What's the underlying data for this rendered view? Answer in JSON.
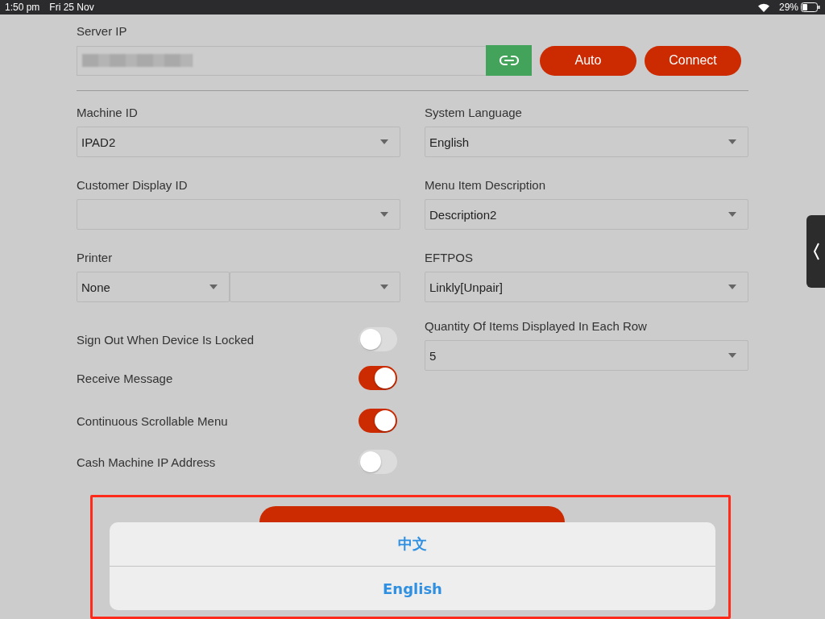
{
  "status_bar": {
    "time": "1:50 pm",
    "date": "Fri 25 Nov",
    "battery": "29%"
  },
  "server_ip": {
    "label": "Server IP",
    "buttons": [
      "Auto",
      "Connect"
    ]
  },
  "left_fields": [
    {
      "label": "Machine ID",
      "kind": "select",
      "value": "IPAD2"
    },
    {
      "label": "Customer Display ID",
      "kind": "select"
    },
    {
      "label": "Printer",
      "kind": "split",
      "value": "None"
    }
  ],
  "toggles": [
    {
      "label": "Sign Out When Device Is Locked",
      "on": false
    },
    {
      "label": "Receive Message",
      "on": true
    },
    {
      "label": "Continuous Scrollable Menu",
      "on": true
    },
    {
      "label": "Cash Machine IP Address",
      "on": false
    }
  ],
  "right_fields": [
    {
      "label": "System Language",
      "value": "English"
    },
    {
      "label": "Menu Item Description",
      "value": "Description2"
    },
    {
      "label": "EFTPOS",
      "value": "Linkly[Unpair]"
    },
    {
      "label": "Quantity Of Items Displayed In Each Row",
      "value": "5"
    }
  ],
  "action_sheet": {
    "options": [
      "中文",
      "English"
    ]
  }
}
